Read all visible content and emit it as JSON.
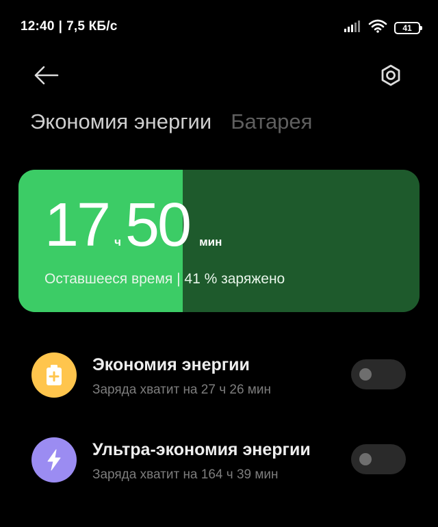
{
  "status_bar": {
    "time": "12:40",
    "separator": "|",
    "network_speed": "7,5 КБ/с",
    "battery_level": "41",
    "icons": [
      "signal-icon",
      "wifi-icon",
      "battery-icon"
    ]
  },
  "top_bar": {
    "back_icon": "arrow-left-icon",
    "settings_icon": "hexagon-settings-icon"
  },
  "tabs": [
    {
      "label": "Экономия энергии",
      "active": true
    },
    {
      "label": "Батарея",
      "active": false
    }
  ],
  "battery_card": {
    "hours": "17",
    "hours_unit": "ч",
    "minutes": "50",
    "minutes_unit": "мин",
    "remaining_text": "Оставшееся время | 41 % заряжено",
    "charge_fraction": 0.41,
    "fill_color": "#3ccc66",
    "empty_color": "#1e5a2c"
  },
  "modes": [
    {
      "title": "Экономия энергии",
      "subtitle": "Заряда хватит на 27 ч 26 мин",
      "icon": "battery-plus-icon",
      "icon_color": "#ffc54d",
      "enabled": false
    },
    {
      "title": "Ультра-экономия энергии",
      "subtitle": "Заряда хватит на 164 ч 39 мин",
      "icon": "lightning-icon",
      "icon_color": "#9b8cf2",
      "enabled": false
    }
  ]
}
